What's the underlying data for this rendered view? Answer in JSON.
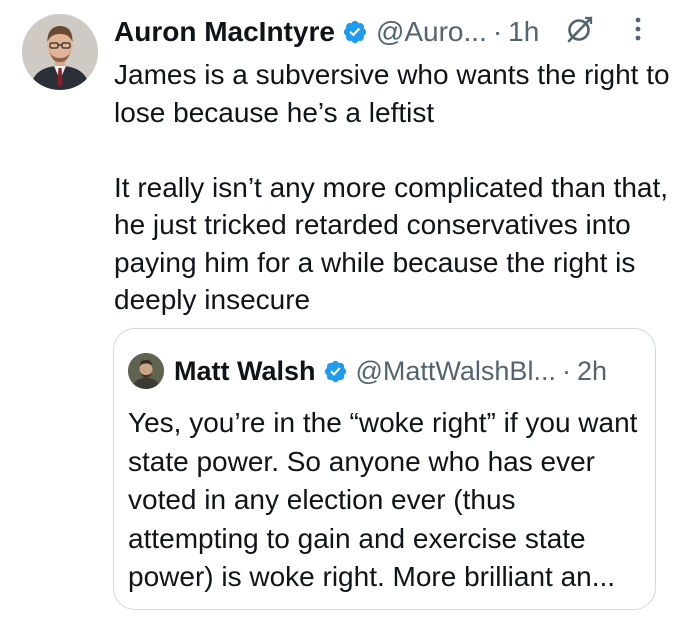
{
  "tweet": {
    "author_name": "Auron MacIntyre",
    "handle": "@Auro...",
    "separator": "·",
    "time": "1h",
    "verified_icon": "verified-badge-icon",
    "paragraphs": [
      "James is a subversive who wants the right to lose because he’s a leftist",
      "It really isn’t any more complicated than that, he just tricked retarded conservatives into paying him for a while because the right is deeply insecure"
    ]
  },
  "quoted": {
    "author_name": "Matt Walsh",
    "handle": "@MattWalshBl...",
    "separator": "·",
    "time": "2h",
    "text": "Yes, you’re in the “woke right” if you want state power. So anyone who has ever voted in any election ever (thus attempting to gain and exercise state power) is woke right. More brilliant an..."
  },
  "colors": {
    "text": "#0f1419",
    "secondary": "#536471",
    "verified": "#1d9bf0",
    "border": "#cfd9de"
  }
}
